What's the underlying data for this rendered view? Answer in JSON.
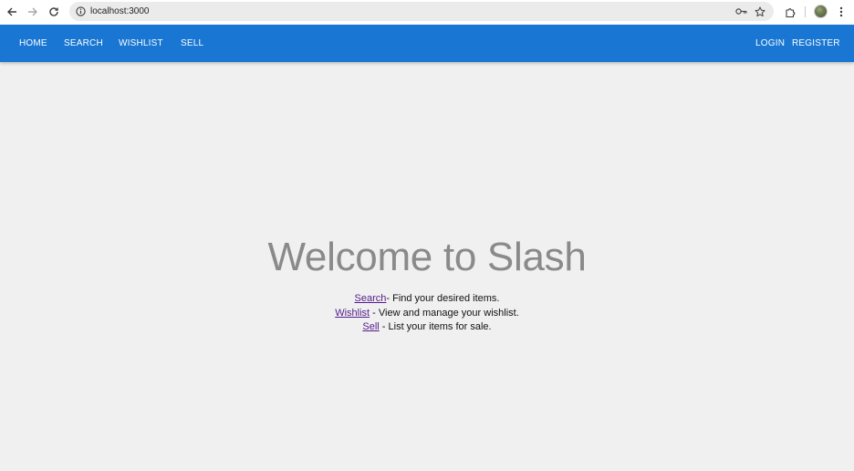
{
  "browser": {
    "url": "localhost:3000",
    "icons": {
      "back": "arrow-left-icon",
      "forward": "arrow-right-icon",
      "reload": "reload-icon",
      "site_info": "info-icon",
      "password": "key-icon",
      "bookmark": "star-icon",
      "extensions": "puzzle-icon",
      "profile": "avatar",
      "menu": "kebab-menu-icon"
    }
  },
  "appbar": {
    "color": "#1976d2",
    "left_links": [
      "HOME",
      "SEARCH",
      "WISHLIST",
      "SELL"
    ],
    "right_links": [
      "LOGIN",
      "REGISTER"
    ]
  },
  "hero": {
    "title": "Welcome to Slash",
    "lines": [
      {
        "link": "Search",
        "text": "- Find your desired items."
      },
      {
        "link": "Wishlist",
        "text": " - View and manage your wishlist."
      },
      {
        "link": "Sell",
        "text": " - List your items for sale."
      }
    ]
  }
}
